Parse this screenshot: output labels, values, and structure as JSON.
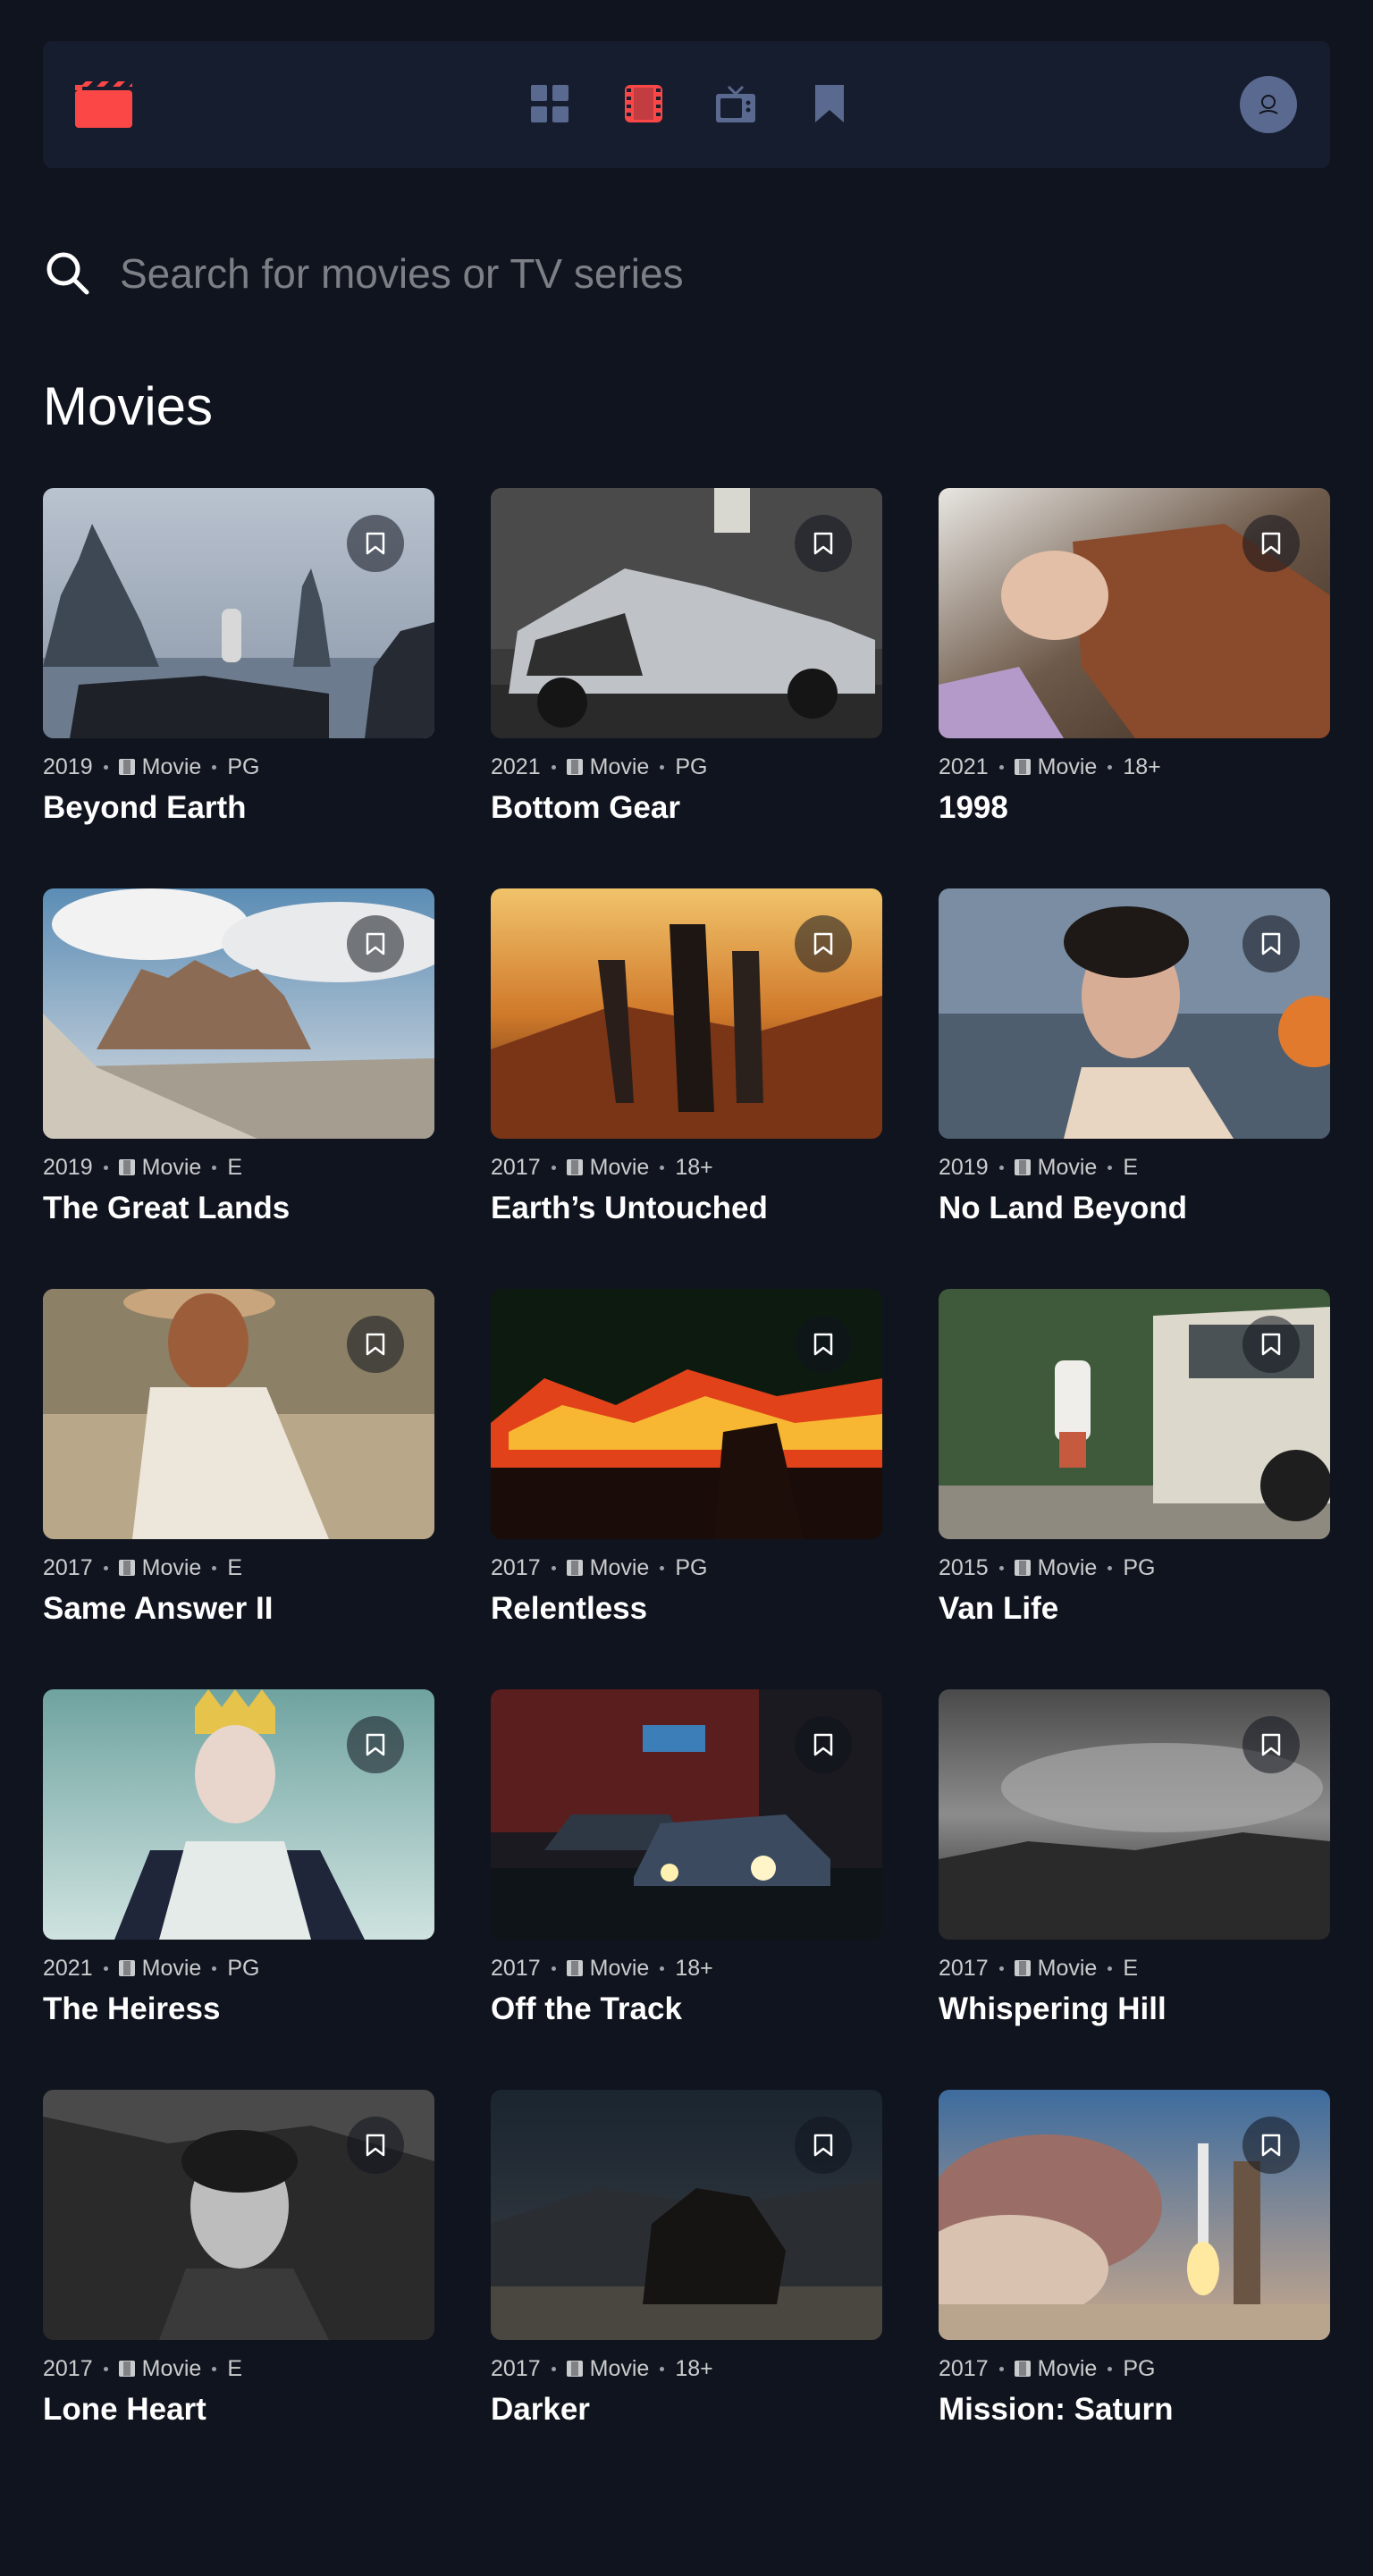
{
  "nav": {
    "logo_icon": "movie-clapper-icon",
    "items": [
      {
        "name": "nav-home",
        "icon": "grid-icon",
        "active": false
      },
      {
        "name": "nav-movies",
        "icon": "film-icon",
        "active": true
      },
      {
        "name": "nav-tv-series",
        "icon": "tv-icon",
        "active": false
      },
      {
        "name": "nav-bookmarks",
        "icon": "bookmark-icon",
        "active": false
      }
    ],
    "avatar_icon": "user-avatar-icon"
  },
  "search": {
    "placeholder": "Search for movies or TV series",
    "value": ""
  },
  "section": {
    "title": "Movies"
  },
  "colors": {
    "background": "#10141E",
    "navbar": "#161D2F",
    "accent": "#FC4747",
    "nav_inactive": "#5A698F"
  },
  "movies": [
    {
      "year": "2019",
      "category": "Movie",
      "rating": "PG",
      "title": "Beyond Earth"
    },
    {
      "year": "2021",
      "category": "Movie",
      "rating": "PG",
      "title": "Bottom Gear"
    },
    {
      "year": "2021",
      "category": "Movie",
      "rating": "18+",
      "title": "1998"
    },
    {
      "year": "2019",
      "category": "Movie",
      "rating": "E",
      "title": "The Great Lands"
    },
    {
      "year": "2017",
      "category": "Movie",
      "rating": "18+",
      "title": "Earth’s Untouched"
    },
    {
      "year": "2019",
      "category": "Movie",
      "rating": "E",
      "title": "No Land Beyond"
    },
    {
      "year": "2017",
      "category": "Movie",
      "rating": "E",
      "title": "Same Answer II"
    },
    {
      "year": "2017",
      "category": "Movie",
      "rating": "PG",
      "title": "Relentless"
    },
    {
      "year": "2015",
      "category": "Movie",
      "rating": "PG",
      "title": "Van Life"
    },
    {
      "year": "2021",
      "category": "Movie",
      "rating": "PG",
      "title": "The Heiress"
    },
    {
      "year": "2017",
      "category": "Movie",
      "rating": "18+",
      "title": "Off the Track"
    },
    {
      "year": "2017",
      "category": "Movie",
      "rating": "E",
      "title": "Whispering Hill"
    },
    {
      "year": "2017",
      "category": "Movie",
      "rating": "E",
      "title": "Lone Heart"
    },
    {
      "year": "2017",
      "category": "Movie",
      "rating": "18+",
      "title": "Darker"
    },
    {
      "year": "2017",
      "category": "Movie",
      "rating": "PG",
      "title": "Mission: Saturn"
    }
  ]
}
